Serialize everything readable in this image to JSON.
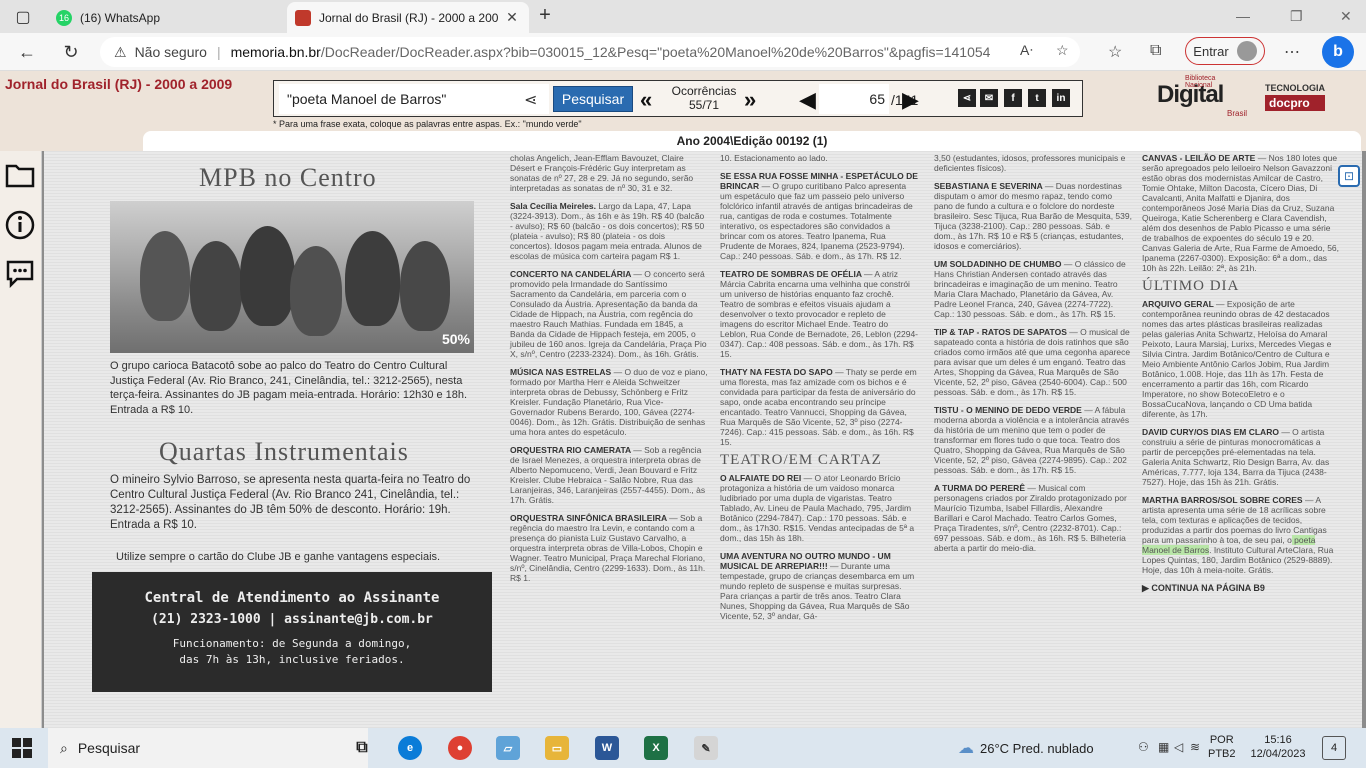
{
  "browser": {
    "tabs": [
      {
        "title": "(16) WhatsApp",
        "badge": "16"
      },
      {
        "title": "Jornal do Brasil (RJ) - 2000 a 200"
      }
    ],
    "not_secure": "Não seguro",
    "url_host": "memoria.bn.br",
    "url_path": "/DocReader/DocReader.aspx?bib=030015_12&Pesq=\"poeta%20Manoel%20de%20Barros\"&pagfis=141054",
    "entrar_label": "Entrar"
  },
  "header": {
    "site_title": "Jornal do Brasil (RJ) - 2000 a 2009",
    "search_value": "\"poeta Manoel de Barros\"",
    "search_button": "Pesquisar",
    "ocorrencias_label": "Ocorrências",
    "ocorrencias_value": "55/71",
    "page_current": "65",
    "page_total": "/151",
    "hint": "* Para uma frase exata, coloque as palavras entre aspas. Ex.: \"mundo verde\"",
    "edition": "Ano 2004\\Edição 00192 (1)",
    "logo_digital": "Digital",
    "logo_small": "Biblioteca Nacional",
    "logo_brasil": "Brasil",
    "logo_tecnologia": "TECNOLOGIA",
    "logo_docpro": "docpro",
    "social": [
      "f",
      "t",
      "in"
    ]
  },
  "newspaper": {
    "mpb_title": "MPB no Centro",
    "photo_badge": "50%",
    "mpb_text": "O grupo carioca Batacotô sobe ao palco do Teatro do Centro Cultural Justiça Federal (Av. Rio Branco, 241, Cinelândia, tel.: 3212-2565), nesta terça-feira. Assinantes do JB pagam meia-entrada. Horário: 12h30 e 18h. Entrada a R$ 10.",
    "quartas_title": "Quartas Instrumentais",
    "quartas_text": "O mineiro Sylvio Barroso, se apresenta nesta quarta-feira no Teatro do Centro Cultural Justiça Federal (Av. Rio Branco 241, Cinelândia, tel.: 3212-2565). Assinantes do JB têm 50% de desconto. Horário: 19h. Entrada a R$ 10.",
    "cta": "Utilize sempre o cartão do Clube JB e ganhe vantagens especiais.",
    "atendimento_1": "Central de Atendimento ao Assinante",
    "atendimento_2": "(21) 2323-1000 | assinante@jb.com.br",
    "atendimento_3": "Funcionamento: de Segunda a domingo,",
    "atendimento_4": "das 7h às 13h, inclusive feriados.",
    "col2": [
      {
        "head": "",
        "body": "cholas Angelich, Jean-Efflam Bavouzet, Claire Désert e François-Frédéric Guy interpretam as sonatas de nº 27, 28 e 29. Já no segundo, serão interpretadas as sonatas de nº 30, 31 e 32."
      },
      {
        "head": "Sala Cecília Meireles.",
        "body": "Largo da Lapa, 47, Lapa (3224-3913). Dom., às 16h e às 19h. R$ 40 (balcão - avulso); R$ 60 (balcão - os dois concertos); R$ 50 (plateia - avulso); R$ 80 (plateia - os dois concertos). Idosos pagam meia entrada. Alunos de escolas de música com carteira pagam R$ 1."
      },
      {
        "head": "CONCERTO NA CANDELÁRIA",
        "body": "— O concerto será promovido pela Irmandade do Santíssimo Sacramento da Candelária, em parceria com o Consulado da Áustria. Apresentação da banda da Cidade de Hippach, na Áustria, com regência do maestro Rauch Mathias. Fundada em 1845, a Banda da Cidade de Hippach festeja, em 2005, o jubileu de 160 anos. Igreja da Candelária, Praça Pio X, s/nº, Centro (2233-2324). Dom., às 16h. Grátis."
      },
      {
        "head": "MÚSICA NAS ESTRELAS",
        "body": "— O duo de voz e piano, formado por Martha Herr e Aleida Schweitzer interpreta obras de Debussy, Schönberg e Fritz Kreisler. Fundação Planetário, Rua Vice-Governador Rubens Berardo, 100, Gávea (2274-0046). Dom., às 12h. Grátis. Distribuição de senhas uma hora antes do espetáculo."
      },
      {
        "head": "ORQUESTRA RIO CAMERATA",
        "body": "— Sob a regência de Israel Menezes, a orquestra interpreta obras de Alberto Nepomuceno, Verdi, Jean Bouvard e Fritz Kreisler. Clube Hebraica - Salão Nobre, Rua das Laranjeiras, 346, Laranjeiras (2557-4455). Dom., às 17h. Grátis."
      },
      {
        "head": "ORQUESTRA SINFÔNICA BRASILEIRA",
        "body": "— Sob a regência do maestro Ira Levin, e contando com a presença do pianista Luiz Gustavo Carvalho, a orquestra interpreta obras de Villa-Lobos, Chopin e Wagner. Teatro Municipal, Praça Marechal Floriano, s/nº, Cinelândia, Centro (2299-1633). Dom., às 11h. R$ 1."
      }
    ],
    "col3": [
      {
        "head": "",
        "body": "10. Estacionamento ao lado."
      },
      {
        "head": "SE ESSA RUA FOSSE MINHA - ESPETÁCULO DE BRINCAR",
        "body": "— O grupo curitibano Palco apresenta um espetáculo que faz um passeio pelo universo folclórico infantil através de antigas brincadeiras de rua, cantigas de roda e costumes. Totalmente interativo, os espectadores são convidados a brincar com os atores. Teatro Ipanema, Rua Prudente de Moraes, 824, Ipanema (2523-9794). Cap.: 240 pessoas. Sáb. e dom., às 17h. R$ 12."
      },
      {
        "head": "TEATRO DE SOMBRAS DE OFÉLIA",
        "body": "— A atriz Márcia Cabrita encarna uma velhinha que constrói um universo de histórias enquanto faz crochê. Teatro de sombras e efeitos visuais ajudam a desenvolver o texto provocador e repleto de imagens do escritor Michael Ende. Teatro do Leblon, Rua Conde de Bernadote, 26, Leblon (2294-0347). Cap.: 408 pessoas. Sáb. e dom., às 17h. R$ 15."
      },
      {
        "head": "THATY NA FESTA DO SAPO",
        "body": "— Thaty se perde em uma floresta, mas faz amizade com os bichos e é convidada para participar da festa de aniversário do sapo, onde acaba encontrando seu príncipe encantado. Teatro Vannucci, Shopping da Gávea, Rua Marquês de São Vicente, 52, 3º piso (2274-7246). Cap.: 415 pessoas. Sáb. e dom., às 16h. R$ 15."
      },
      {
        "head": "O ALFAIATE DO REI",
        "body": "— O ator Leonardo Brício protagoniza a história de um vaidoso monarca ludibriado por uma dupla de vigaristas. Teatro Tablado, Av. Lineu de Paula Machado, 795, Jardim Botânico (2294-7847). Cap.: 170 pessoas. Sáb. e dom., às 17h30. R$15. Vendas antecipadas de 5ª a dom., das 15h às 18h."
      },
      {
        "head": "UMA AVENTURA NO OUTRO MUNDO - UM MUSICAL DE ARREPIAR!!!",
        "body": "— Durante uma tempestade, grupo de crianças desembarca em um mundo repleto de suspense e muitas surpresas. Para crianças a partir de três anos. Teatro Clara Nunes, Shopping da Gávea, Rua Marquês de São Vicente, 52, 3º andar, Gá-"
      }
    ],
    "col3_section": "TEATRO/EM CARTAZ",
    "col4": [
      {
        "head": "",
        "body": "3,50 (estudantes, idosos, professores municipais e deficientes físicos)."
      },
      {
        "head": "SEBASTIANA E SEVERINA",
        "body": "— Duas nordestinas disputam o amor do mesmo rapaz, tendo como pano de fundo a cultura e o folclore do nordeste brasileiro. Sesc Tijuca, Rua Barão de Mesquita, 539, Tijuca (3238-2100). Cap.: 280 pessoas. Sáb. e dom., às 17h. R$ 10 e R$ 5 (crianças, estudantes, idosos e comerciários)."
      },
      {
        "head": "UM SOLDADINHO DE CHUMBO",
        "body": "— O clássico de Hans Christian Andersen contado através das brincadeiras e imaginação de um menino. Teatro Maria Clara Machado, Planetário da Gávea, Av. Padre Leonel Franca, 240, Gávea (2274-7722). Cap.: 130 pessoas. Sáb. e dom., às 17h. R$ 15."
      },
      {
        "head": "TIP & TAP - RATOS DE SAPATOS",
        "body": "— O musical de sapateado conta a história de dois ratinhos que são criados como irmãos até que uma cegonha aparece para avisar que um deles é um enganó. Teatro das Artes, Shopping da Gávea, Rua Marquês de São Vicente, 52, 2º piso, Gávea (2540-6004). Cap.: 500 pessoas. Sáb. e dom., às 17h. R$ 15."
      },
      {
        "head": "TISTU - O MENINO DE DEDO VERDE",
        "body": "— A fábula moderna aborda a violência e a intolerância através da história de um menino que tem o poder de transformar em flores tudo o que toca. Teatro dos Quatro, Shopping da Gávea, Rua Marquês de São Vicente, 52, 2º piso, Gávea (2274-9895). Cap.: 202 pessoas. Sáb. e dom., às 17h. R$ 15."
      },
      {
        "head": "A TURMA DO PERERÊ",
        "body": "— Musical com personagens criados por Ziraldo protagonizado por Maurício Tizumba, Isabel Fillardis, Alexandre Barillari e Carol Machado. Teatro Carlos Gomes, Praça Tiradentes, s/nº, Centro (2232-8701). Cap.: 697 pessoas. Sáb. e dom., às 16h. R$ 5. Bilheteria aberta a partir do meio-dia."
      }
    ],
    "col5": [
      {
        "head": "CANVAS - LEILÃO DE ARTE",
        "body": "— Nos 180 lotes que serão apregoados pelo leiloeiro Nelson Gavazzoni estão obras dos modernistas Amilcar de Castro, Tomie Ohtake, Milton Dacosta, Cícero Dias, Di Cavalcanti, Anita Malfatti e Djanira, dos contemporâneos José Maria Dias da Cruz, Suzana Queiroga, Katie Scherenberg e Clara Cavendish, além dos desenhos de Pablo Picasso e uma série de trabalhos de expoentes do século 19 e 20. Canvas Galeria de Arte, Rua Farme de Amoedo, 56, Ipanema (2267-0300). Exposição: 6ª a dom., das 10h às 22h. Leilão: 2ª, às 21h."
      },
      {
        "head": "ARQUIVO GERAL",
        "body": "— Exposição de arte contemporânea reunindo obras de 42 destacados nomes das artes plásticas brasileiras realizadas pelas galerias Anita Schwartz, Heloísa do Amaral Peixoto, Laura Marsiaj, Lurixs, Mercedes Viegas e Silvia Cintra. Jardim Botânico/Centro de Cultura e Meio Ambiente Antônio Carlos Jobim, Rua Jardim Botânico, 1.008. Hoje, das 11h às 17h. Festa de encerramento a partir das 16h, com Ricardo Imperatore, no show BotecoEletro e o BossaCucaNova, lançando o CD Uma batida diferente, às 17h."
      },
      {
        "head": "DAVID CURY/OS DIAS EM CLARO",
        "body": "— O artista construiu a série de pinturas monocromáticas a partir de percepções pré-elementadas na tela. Galeria Anita Schwartz, Rio Design Barra, Av. das Américas, 7.777, loja 134, Barra da Tijuca (2438-7527). Hoje, das 15h às 21h. Grátis."
      },
      {
        "head": "MARTHA BARROS/SOL SOBRE CORES",
        "body": "— A artista apresenta uma série de 18 acrílicas sobre tela, com texturas e aplicações de tecidos, produzidas a partir dos poemas do livro Cantigas para um passarinho à toa, de seu pai, o"
      }
    ],
    "col5_highlight": "poeta Manoel de Barros",
    "col5_after": ". Instituto Cultural ArteClara, Rua Lopes Quintas, 180, Jardim Botânico (2529-8889). Hoje, das 10h à meia-noite. Grátis.",
    "col5_section": "ÚLTIMO DIA",
    "continua": "▶ CONTINUA NA PÁGINA B9"
  },
  "taskbar": {
    "search": "Pesquisar",
    "weather": "26°C  Pred. nublado",
    "lang_1": "POR",
    "lang_2": "PTB2",
    "time": "15:16",
    "date": "12/04/2023",
    "notifications": "4"
  }
}
